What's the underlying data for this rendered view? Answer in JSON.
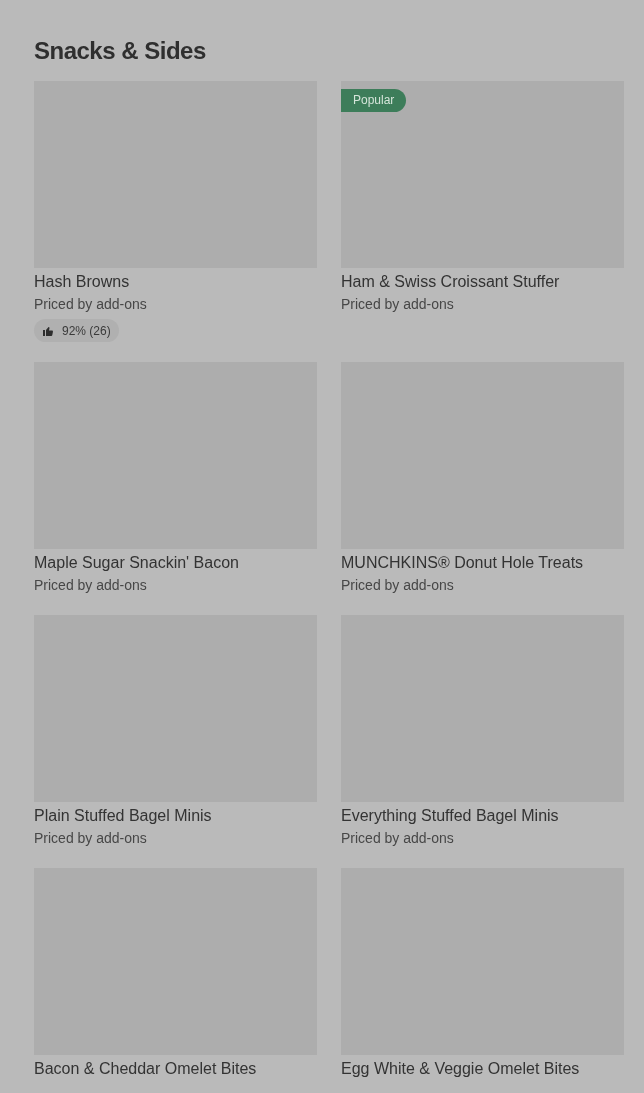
{
  "section": {
    "title": "Snacks & Sides"
  },
  "rows": [
    {
      "cards": [
        {
          "name": "Hash Browns",
          "price": "Priced by add-ons",
          "rating": "92% (26)"
        },
        {
          "badge": "Popular",
          "name": "Ham & Swiss Croissant Stuffer",
          "price": "Priced by add-ons"
        }
      ]
    },
    {
      "cards": [
        {
          "name": "Maple Sugar Snackin' Bacon",
          "price": "Priced by add-ons"
        },
        {
          "name": "MUNCHKINS® Donut Hole Treats",
          "price": "Priced by add-ons"
        }
      ]
    },
    {
      "cards": [
        {
          "name": "Plain Stuffed Bagel Minis",
          "price": "Priced by add-ons"
        },
        {
          "name": "Everything Stuffed Bagel Minis",
          "price": "Priced by add-ons"
        }
      ]
    },
    {
      "cards": [
        {
          "name": "Bacon & Cheddar Omelet Bites"
        },
        {
          "name": "Egg White & Veggie Omelet Bites"
        }
      ]
    }
  ]
}
